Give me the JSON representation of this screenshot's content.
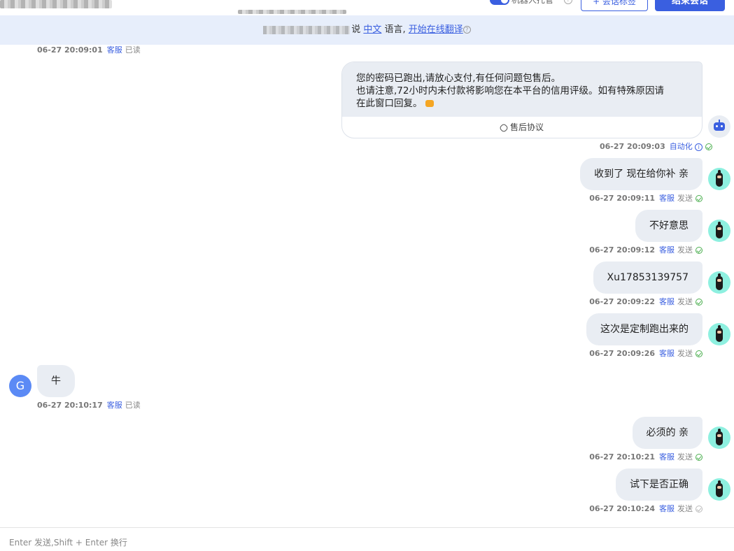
{
  "header": {
    "robot_toggle_label": "机器人托管",
    "add_tag_button": "+ 会话标签",
    "end_chat_button": "结束会话"
  },
  "translate_bar": {
    "say_label": "说",
    "language_link": "中文",
    "language_suffix": "语言,",
    "translate_link": "开始在线翻译"
  },
  "colors": {
    "accent": "#3a5fe0",
    "bubble_bg": "#e9edf3",
    "translate_bar_bg": "#e7eefb",
    "sent_check": "#4caf50"
  },
  "messages": [
    {
      "side": "left",
      "meta_only": true,
      "time": "06-27 20:09:01",
      "operator": "客服",
      "status": "已读"
    },
    {
      "side": "right",
      "type": "card",
      "avatar": "robot-icon",
      "lines": [
        "您的密码已跑出,请放心支付,有任何问题包售后。",
        "也请注意,72小时内未付款将影响您在本平台的信用评级。如有特殊原因请",
        "在此窗口回复。"
      ],
      "footer_link": "售后协议",
      "time": "06-27 20:09:03",
      "operator": "自动化",
      "status_icon": "info-icon"
    },
    {
      "side": "right",
      "text": "收到了 现在给你补 亲",
      "avatar": "bearded-avatar",
      "time": "06-27 20:09:11",
      "operator": "客服",
      "status": "发送"
    },
    {
      "side": "right",
      "text": "不好意思",
      "avatar": "bearded-avatar",
      "time": "06-27 20:09:12",
      "operator": "客服",
      "status": "发送"
    },
    {
      "side": "right",
      "text": "Xu17853139757",
      "avatar": "bearded-avatar",
      "time": "06-27 20:09:22",
      "operator": "客服",
      "status": "发送"
    },
    {
      "side": "right",
      "text": "这次是定制跑出来的",
      "avatar": "bearded-avatar",
      "time": "06-27 20:09:26",
      "operator": "客服",
      "status": "发送"
    },
    {
      "side": "left",
      "text": "牛",
      "avatar_letter": "G",
      "time": "06-27 20:10:17",
      "operator": "客服",
      "status": "已读"
    },
    {
      "side": "right",
      "text": "必须的 亲",
      "avatar": "bearded-avatar",
      "time": "06-27 20:10:21",
      "operator": "客服",
      "status": "发送"
    },
    {
      "side": "right",
      "text": "试下是否正确",
      "avatar": "bearded-avatar",
      "time": "06-27 20:10:24",
      "operator": "客服",
      "status": "发送"
    }
  ],
  "input": {
    "hint": "Enter 发送,Shift + Enter 换行"
  }
}
